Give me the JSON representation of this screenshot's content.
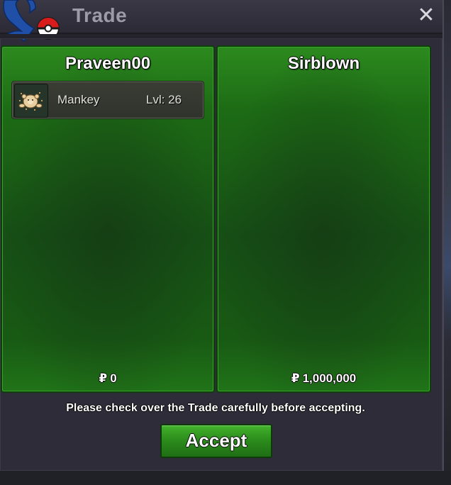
{
  "window": {
    "title": "Trade",
    "close_label": "✕",
    "logo_icon": "pokeball-logo-icon"
  },
  "panels": {
    "left": {
      "player_name": "Praveen00",
      "items": [
        {
          "name": "Mankey",
          "level_label": "Lvl: 26",
          "icon": "mankey-sprite-icon"
        }
      ],
      "currency_symbol": "₽",
      "money": "0"
    },
    "right": {
      "player_name": "Sirblown",
      "items": [],
      "currency_symbol": "₽",
      "money": "1,000,000"
    }
  },
  "notice": "Please check over the Trade carefully before accepting.",
  "actions": {
    "accept_label": "Accept"
  },
  "colors": {
    "panel_green": "#1d6c15",
    "accept_green": "#2c8d1c",
    "title_gray": "#9d9ba6"
  }
}
